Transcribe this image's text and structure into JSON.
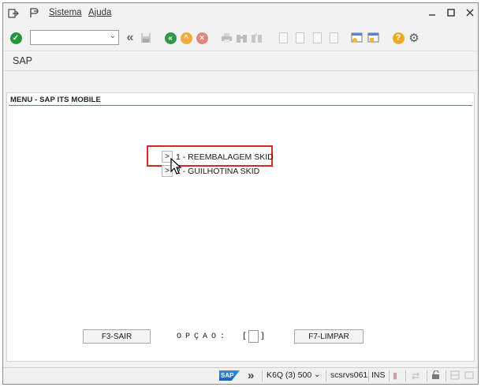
{
  "menubar": {
    "items": [
      {
        "label": "Sistema"
      },
      {
        "label": "Ajuda"
      }
    ]
  },
  "toolbar": {
    "command_field_value": ""
  },
  "title": "SAP",
  "screen": {
    "section_title": "MENU - SAP ITS MOBILE",
    "options": [
      {
        "button": ">",
        "label": "1 - REEMBALAGEM SKID"
      },
      {
        "button": ">",
        "label": "2 - GUILHOTINA SKID"
      }
    ],
    "exit_button": "F3-SAIR",
    "option_label": "OPÇAO:",
    "option_open": "[",
    "option_close": "]",
    "option_value": "",
    "clear_button": "F7-LIMPAR"
  },
  "statusbar": {
    "logo_text": "SAP",
    "system": "K6Q (3) 500",
    "server": "scsrvs061",
    "mode": "INS"
  },
  "colors": {
    "highlight": "#d9262c",
    "section_line": "#5a7fbf",
    "enter_green": "#1e9a3a",
    "back_green": "#2e9a45",
    "exit_orange": "#f2a93b",
    "cancel_red": "#d94a3d",
    "help_orange": "#f0a91f"
  }
}
